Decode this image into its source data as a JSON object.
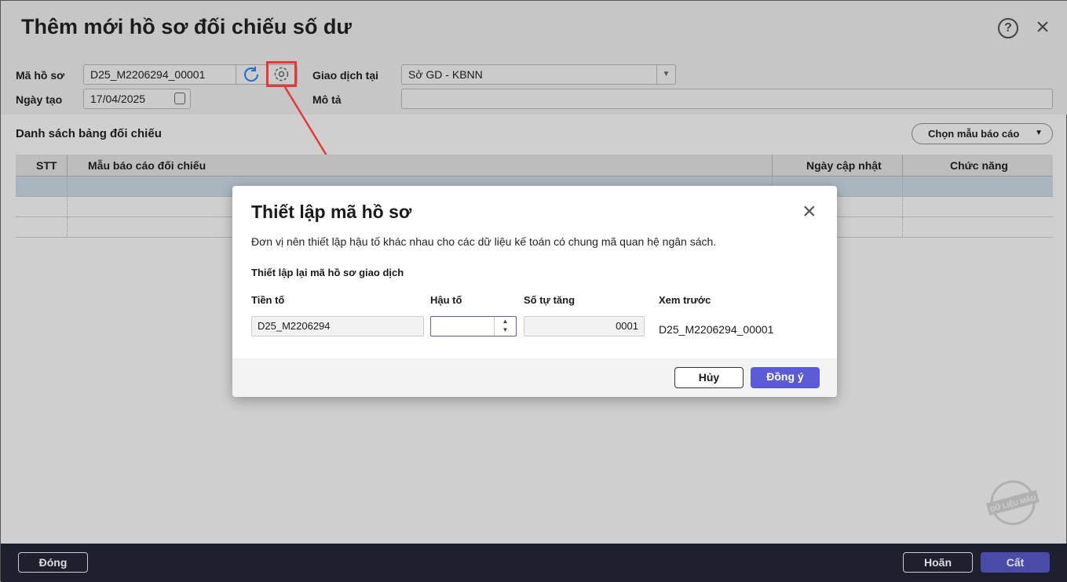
{
  "window": {
    "title": "Thêm mới hồ sơ đối chiếu số dư",
    "help_icon": "?",
    "close_icon": "✕"
  },
  "form": {
    "ma_ho_so_label": "Mã hồ sơ",
    "ma_ho_so_value": "D25_M2206294_00001",
    "ngay_tao_label": "Ngày tạo",
    "ngay_tao_value": "17/04/2025",
    "giao_dich_label": "Giao dịch tại",
    "giao_dich_value": "Sở GD - KBNN",
    "mo_ta_label": "Mô tả",
    "mo_ta_value": ""
  },
  "list": {
    "title": "Danh sách bảng đối chiếu",
    "choose_template": "Chọn mẫu báo cáo",
    "columns": [
      "STT",
      "Mẫu báo cáo đối chiếu",
      "Ngày cập nhật",
      "Chức năng"
    ]
  },
  "modal": {
    "title": "Thiết lập mã hồ sơ",
    "description": "Đơn vị nên thiết lập hậu tố khác nhau cho các dữ liệu kế toán có chung mã quan hệ ngân sách.",
    "subtitle": "Thiết lập lại mã hồ sơ giao dịch",
    "prefix_label": "Tiền tố",
    "prefix_value": "D25_M2206294",
    "suffix_label": "Hậu tố",
    "suffix_value": "",
    "counter_label": "Số tự tăng",
    "counter_value": "0001",
    "preview_label": "Xem trước",
    "preview_value": "D25_M2206294_00001",
    "cancel": "Hủy",
    "ok": "Đồng ý"
  },
  "footer": {
    "close": "Đóng",
    "undo": "Hoãn",
    "save": "Cất"
  },
  "watermark": "DỮ LIỆU MẪU",
  "colors": {
    "primary": "#5b5bd6",
    "highlight": "#e53935"
  }
}
